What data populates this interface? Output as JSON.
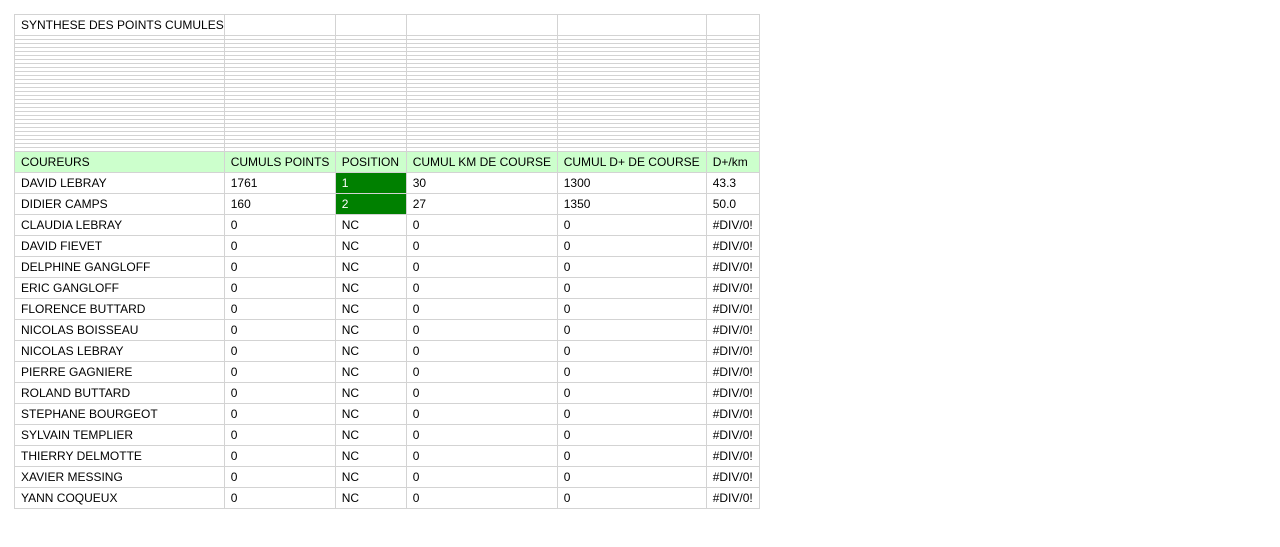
{
  "sheet": {
    "title": "SYNTHESE DES POINTS CUMULES",
    "headers": [
      "COUREURS",
      "CUMULS POINTS",
      "POSITION",
      "CUMUL KM DE COURSE",
      "CUMUL D+ DE COURSE",
      "D+/km"
    ],
    "highlight_color": "#008000",
    "header_color": "#ccffcc",
    "rows": [
      {
        "name": "DAVID LEBRAY",
        "points": "1761",
        "position": "1",
        "km": "30",
        "dplus": "1300",
        "ratio": "43.3",
        "highlight": true
      },
      {
        "name": "DIDIER CAMPS",
        "points": "160",
        "position": "2",
        "km": "27",
        "dplus": "1350",
        "ratio": "50.0",
        "highlight": true
      },
      {
        "name": "CLAUDIA LEBRAY",
        "points": "0",
        "position": "NC",
        "km": "0",
        "dplus": "0",
        "ratio": "#DIV/0!",
        "highlight": false
      },
      {
        "name": "DAVID FIEVET",
        "points": "0",
        "position": "NC",
        "km": "0",
        "dplus": "0",
        "ratio": "#DIV/0!",
        "highlight": false
      },
      {
        "name": "DELPHINE GANGLOFF",
        "points": "0",
        "position": "NC",
        "km": "0",
        "dplus": "0",
        "ratio": "#DIV/0!",
        "highlight": false
      },
      {
        "name": "ERIC GANGLOFF",
        "points": "0",
        "position": "NC",
        "km": "0",
        "dplus": "0",
        "ratio": "#DIV/0!",
        "highlight": false
      },
      {
        "name": "FLORENCE BUTTARD",
        "points": "0",
        "position": "NC",
        "km": "0",
        "dplus": "0",
        "ratio": "#DIV/0!",
        "highlight": false
      },
      {
        "name": "NICOLAS BOISSEAU",
        "points": "0",
        "position": "NC",
        "km": "0",
        "dplus": "0",
        "ratio": "#DIV/0!",
        "highlight": false
      },
      {
        "name": "NICOLAS LEBRAY",
        "points": "0",
        "position": "NC",
        "km": "0",
        "dplus": "0",
        "ratio": "#DIV/0!",
        "highlight": false
      },
      {
        "name": "PIERRE GAGNIERE",
        "points": "0",
        "position": "NC",
        "km": "0",
        "dplus": "0",
        "ratio": "#DIV/0!",
        "highlight": false
      },
      {
        "name": "ROLAND BUTTARD",
        "points": "0",
        "position": "NC",
        "km": "0",
        "dplus": "0",
        "ratio": "#DIV/0!",
        "highlight": false
      },
      {
        "name": "STEPHANE BOURGEOT",
        "points": "0",
        "position": "NC",
        "km": "0",
        "dplus": "0",
        "ratio": "#DIV/0!",
        "highlight": false
      },
      {
        "name": "SYLVAIN TEMPLIER",
        "points": "0",
        "position": "NC",
        "km": "0",
        "dplus": "0",
        "ratio": "#DIV/0!",
        "highlight": false
      },
      {
        "name": "THIERRY DELMOTTE",
        "points": "0",
        "position": "NC",
        "km": "0",
        "dplus": "0",
        "ratio": "#DIV/0!",
        "highlight": false
      },
      {
        "name": "XAVIER MESSING",
        "points": "0",
        "position": "NC",
        "km": "0",
        "dplus": "0",
        "ratio": "#DIV/0!",
        "highlight": false
      },
      {
        "name": "YANN COQUEUX",
        "points": "0",
        "position": "NC",
        "km": "0",
        "dplus": "0",
        "ratio": "#DIV/0!",
        "highlight": false
      }
    ]
  }
}
